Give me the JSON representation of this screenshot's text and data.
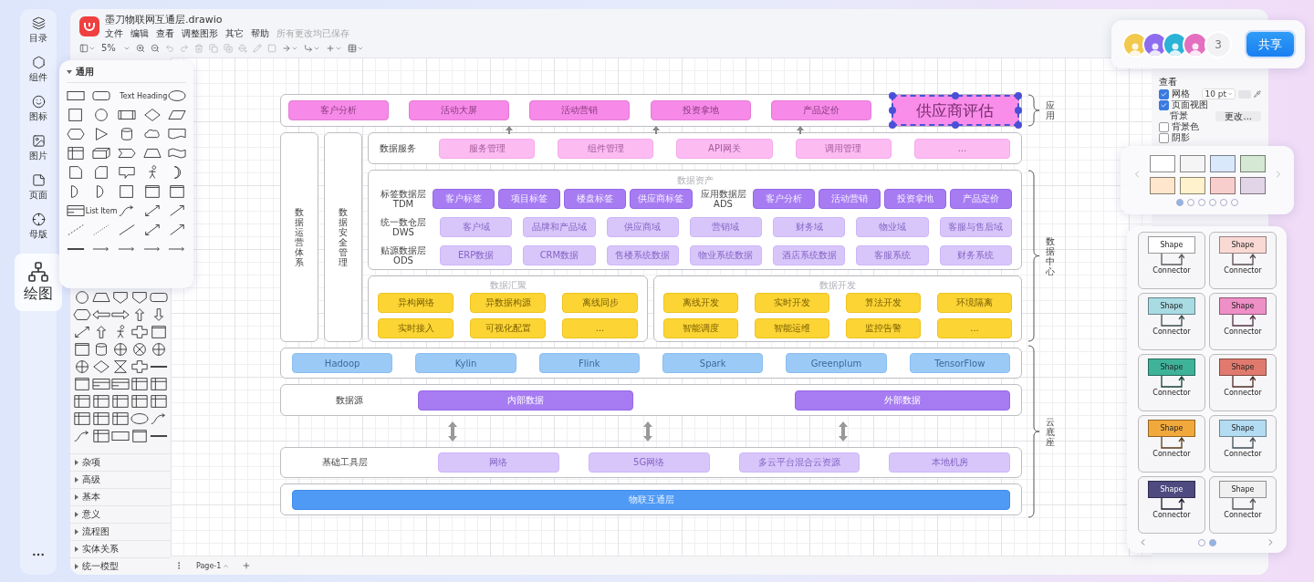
{
  "nav": [
    {
      "label": "目录",
      "selected": false
    },
    {
      "label": "组件",
      "selected": false
    },
    {
      "label": "图标",
      "selected": false
    },
    {
      "label": "图片",
      "selected": false
    },
    {
      "label": "页面",
      "selected": false
    },
    {
      "label": "母版",
      "selected": false
    },
    {
      "label": "绘图",
      "selected": true
    }
  ],
  "document": {
    "title": "墨刀物联网互通层.drawio",
    "menu": [
      "文件",
      "编辑",
      "查看",
      "调整图形",
      "其它",
      "帮助"
    ],
    "save_status": "所有更改均已保存"
  },
  "toolbar": {
    "zoom": "5%"
  },
  "shape_library": {
    "title": "通用",
    "samples": [
      "Text",
      "Heading",
      "List Item"
    ],
    "categories": [
      "杂项",
      "高级",
      "基本",
      "意义",
      "流程图",
      "实体关系",
      "统一模型"
    ]
  },
  "page_tab": "Page-1",
  "collaborators": {
    "avatars": [
      {
        "color": "#f2c94c"
      },
      {
        "color": "#8e6cf0"
      },
      {
        "color": "#2ab3d6"
      },
      {
        "color": "#e46ec0"
      }
    ],
    "more": "3",
    "share": "共享"
  },
  "format_panel": {
    "section": "查看",
    "grid": {
      "label": "网格",
      "checked": true,
      "size": "10 pt"
    },
    "page_view": {
      "label": "页面视图",
      "checked": true
    },
    "background": {
      "label": "背景",
      "button": "更改..."
    },
    "background_color": {
      "label": "背景色",
      "checked": false
    },
    "shadow": {
      "label": "阴影",
      "checked": false
    }
  },
  "palette": {
    "swatches": [
      {
        "color": "#ffffff"
      },
      {
        "color": "#f5f5f5"
      },
      {
        "color": "#dae8fc"
      },
      {
        "color": "#d5e8d4"
      },
      {
        "color": "#ffe6cc"
      },
      {
        "color": "#fff2cc"
      },
      {
        "color": "#f8cecc"
      },
      {
        "color": "#e1d5e7"
      }
    ],
    "pages": [
      {
        "selected": true
      },
      {
        "selected": false
      },
      {
        "selected": false
      },
      {
        "selected": false
      },
      {
        "selected": false
      },
      {
        "selected": false
      }
    ]
  },
  "style_cards": {
    "cards": [
      {
        "shape": "Shape",
        "connector": "Connector",
        "color": "#ffffff"
      },
      {
        "shape": "Shape",
        "connector": "Connector",
        "color": "#fad9d5"
      },
      {
        "shape": "Shape",
        "connector": "Connector",
        "color": "#a9dbe3"
      },
      {
        "shape": "Shape",
        "connector": "Connector",
        "color": "#ee8fc6"
      },
      {
        "shape": "Shape",
        "connector": "Connector",
        "color": "#3fb39a"
      },
      {
        "shape": "Shape",
        "connector": "Connector",
        "color": "#e07a6e"
      },
      {
        "shape": "Shape",
        "connector": "Connector",
        "color": "#f2a93b"
      },
      {
        "shape": "Shape",
        "connector": "Connector",
        "color": "#b3dcf2"
      },
      {
        "shape": "Shape",
        "connector": "Connector",
        "color": "#4f4a80"
      },
      {
        "shape": "Shape",
        "connector": "Connector",
        "color": "#f0f0f0"
      }
    ],
    "pages": [
      {
        "selected": false
      },
      {
        "selected": true
      }
    ]
  },
  "diagram": {
    "apps": [
      {
        "label": "客户分析",
        "selected": false
      },
      {
        "label": "活动大屏",
        "selected": false
      },
      {
        "label": "活动营销",
        "selected": false
      },
      {
        "label": "投资拿地",
        "selected": false
      },
      {
        "label": "产品定价",
        "selected": false
      },
      {
        "label": "供应商评估",
        "selected": true
      }
    ],
    "pillars": [
      "数据运营体系",
      "数据安全管理"
    ],
    "services": {
      "label": "数据服务",
      "items": [
        "服务管理",
        "组件管理",
        "API网关",
        "调用管理",
        "..."
      ]
    },
    "assets": {
      "caption": "数据资产",
      "rows": [
        {
          "kind": "tags",
          "groups": [
            {
              "name": "标签数据层",
              "code": "TDM",
              "items": [
                "客户标签",
                "项目标签",
                "楼盘标签",
                "供应商标签"
              ]
            },
            {
              "name": "应用数据层",
              "code": "ADS",
              "items": [
                "客户分析",
                "活动营销",
                "投资拿地",
                "产品定价"
              ]
            }
          ]
        },
        {
          "kind": "layer",
          "groups": [
            {
              "name": "统一数仓层",
              "code": "DWS",
              "items": [
                "客户域",
                "品牌和产品域",
                "供应商域",
                "营销域",
                "财务域",
                "物业域",
                "客服与售后域"
              ]
            }
          ]
        },
        {
          "kind": "layer",
          "groups": [
            {
              "name": "贴源数据层",
              "code": "ODS",
              "items": [
                "ERP数据",
                "CRM数据",
                "售楼系统数据",
                "物业系统数据",
                "酒店系统数据",
                "客服系统",
                "财务系统"
              ]
            }
          ]
        }
      ]
    },
    "pipelines": [
      {
        "caption": "数据汇聚",
        "items": [
          "异构网络",
          "异数据构源",
          "离线同步",
          "实时接入",
          "可视化配置",
          "..."
        ]
      },
      {
        "caption": "数据开发",
        "items": [
          "离线开发",
          "实时开发",
          "算法开发",
          "环境隔离",
          "智能调度",
          "智能运维",
          "监控告警",
          "..."
        ]
      }
    ],
    "tech": [
      "Hadoop",
      "Kylin",
      "Flink",
      "Spark",
      "Greenplum",
      "TensorFlow"
    ],
    "sources": {
      "label": "数据源",
      "items": [
        "内部数据",
        "外部数据"
      ]
    },
    "tools": {
      "label": "基础工具层",
      "items": [
        "网络",
        "5G网络",
        "多云平台混合云资源",
        "本地机房"
      ]
    },
    "iot": "物联互通层",
    "braces": [
      {
        "label": "应用"
      },
      {
        "label": "数据中心"
      },
      {
        "label": "云底座"
      }
    ]
  }
}
